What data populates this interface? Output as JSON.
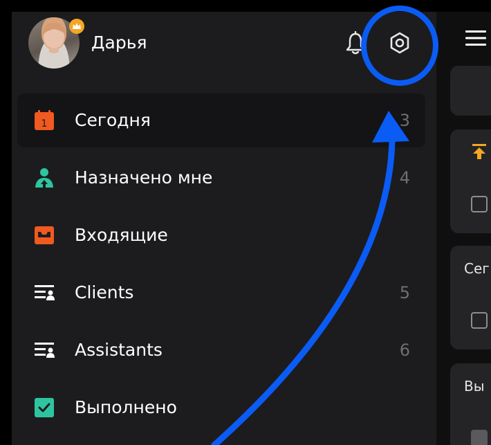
{
  "profile": {
    "name": "Дарья",
    "avatar_icon": "user-photo",
    "badge_icon": "crown-icon",
    "badge_color": "#f5a623"
  },
  "header_icons": {
    "notifications": "bell-icon",
    "settings": "gear-icon"
  },
  "menu": {
    "items": [
      {
        "label": "Сегодня",
        "count": "3",
        "icon": "calendar-today-icon",
        "color": "#f0591f",
        "icon_text": "1",
        "active": true
      },
      {
        "label": "Назначено мне",
        "count": "4",
        "icon": "assigned-person-icon",
        "color": "#2ec4a0",
        "active": false
      },
      {
        "label": "Входящие",
        "count": "",
        "icon": "inbox-icon",
        "color": "#f0591f",
        "active": false
      },
      {
        "label": "Clients",
        "count": "5",
        "icon": "shared-list-icon",
        "color": "#ffffff",
        "active": false
      },
      {
        "label": "Assistants",
        "count": "6",
        "icon": "shared-list-icon",
        "color": "#ffffff",
        "active": false
      },
      {
        "label": "Выполнено",
        "count": "",
        "icon": "completed-check-icon",
        "color": "#2ec4a0",
        "active": false
      }
    ]
  },
  "right_pane": {
    "menu_icon": "hamburger-icon",
    "priority_icon": "priority-arrow-icon",
    "priority_color": "#f5a623",
    "section_today": "Сег",
    "section_done": "Вы"
  },
  "annotation": {
    "color": "#0a5cf5"
  }
}
